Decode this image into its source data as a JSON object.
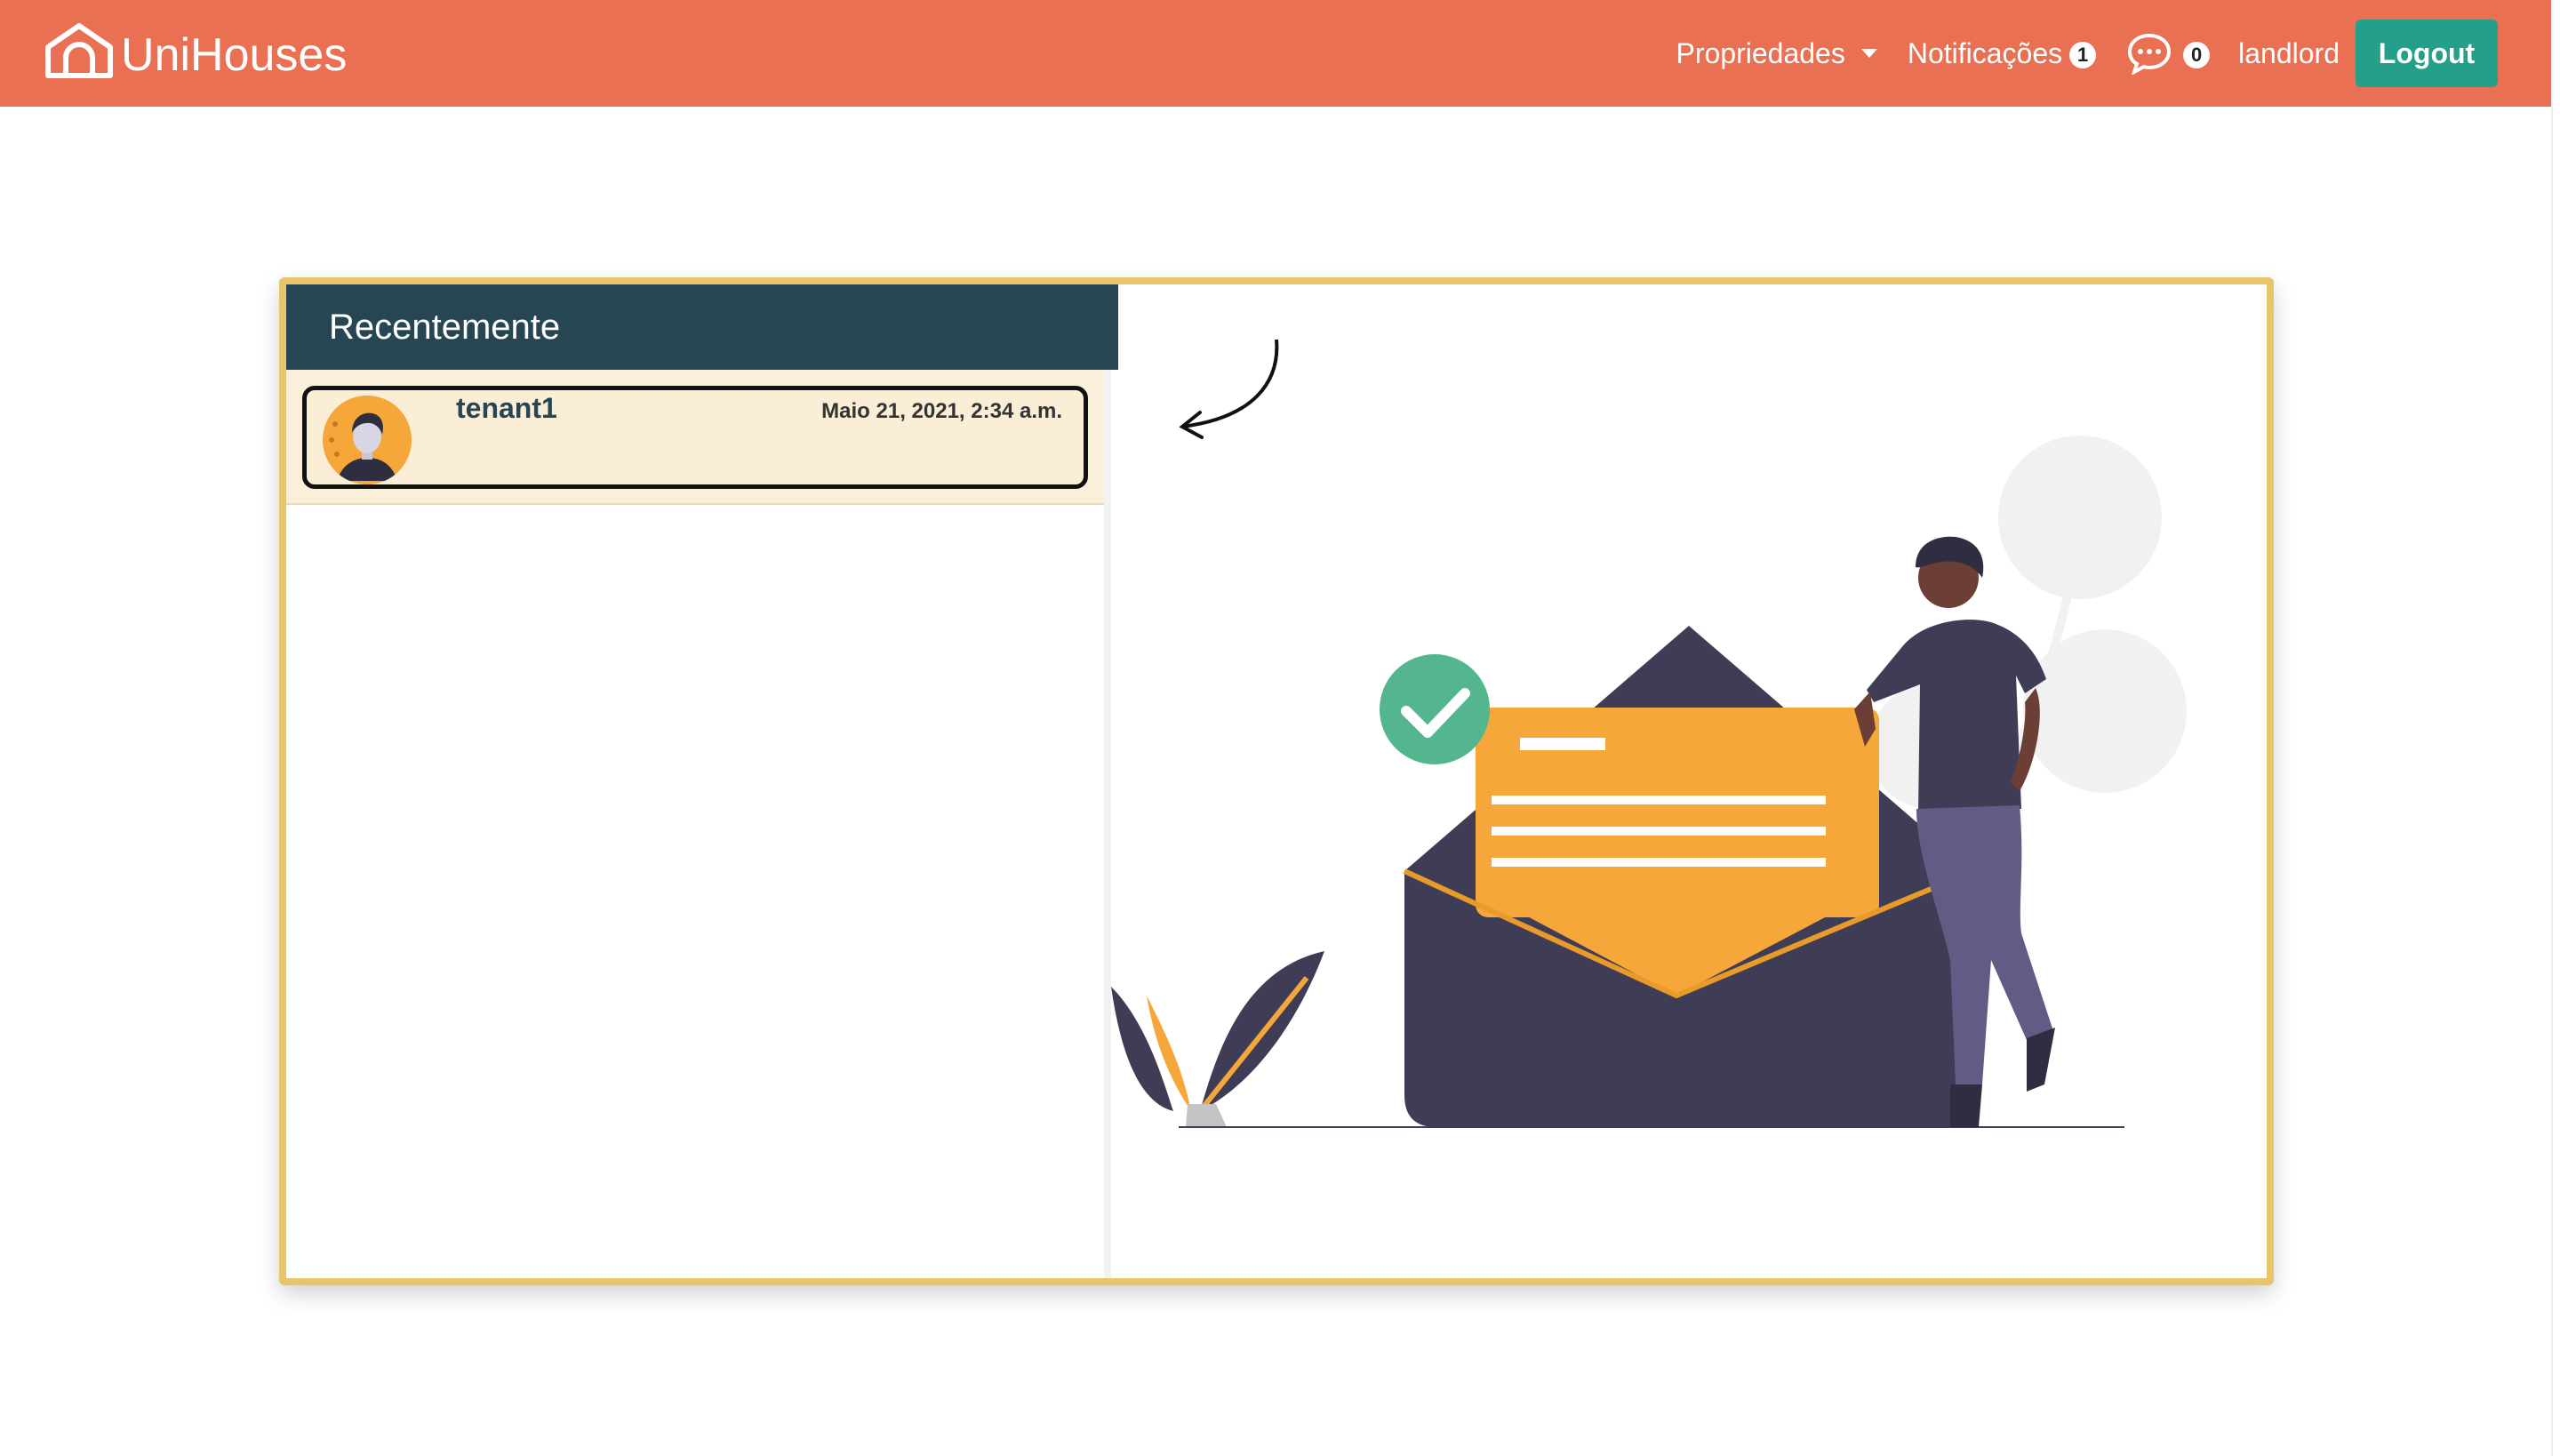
{
  "navbar": {
    "brand": "UniHouses",
    "properties_label": "Propriedades",
    "notifications_label": "Notificações",
    "notifications_count": "1",
    "messages_count": "0",
    "user_label": "landlord",
    "logout_label": "Logout"
  },
  "inbox": {
    "header": "Recentemente",
    "conversations": [
      {
        "name": "tenant1",
        "date": "Maio 21, 2021, 2:34 a.m."
      }
    ]
  },
  "colors": {
    "navbar": "#e97053",
    "logout": "#24a08a",
    "card_border": "#e8c46a",
    "sidebar_header": "#264653",
    "accent": "#f6a739"
  }
}
